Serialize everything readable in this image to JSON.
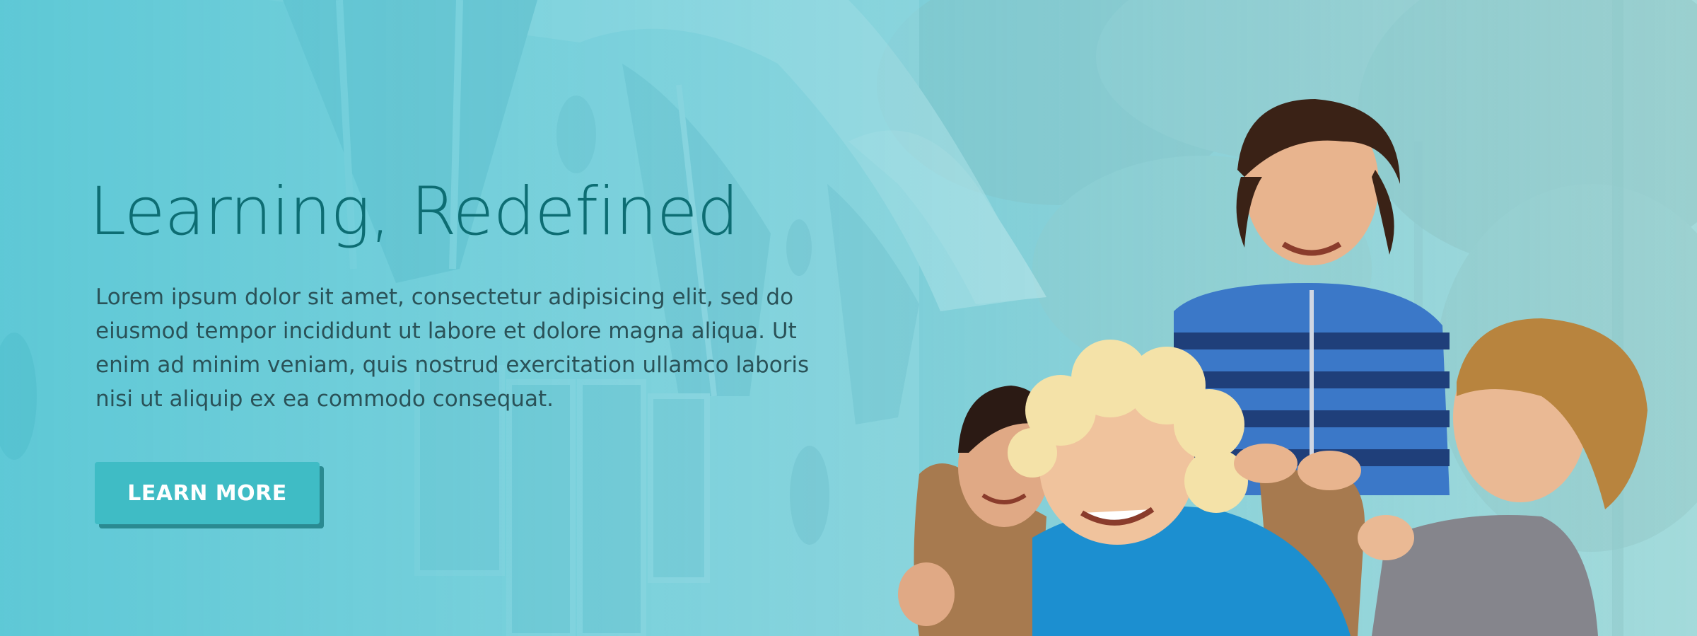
{
  "hero": {
    "headline": "Learning, Redefined",
    "body": "Lorem ipsum dolor sit amet, consectetur adipisicing elit, sed do eiusmod tempor incididunt ut labore et dolore magna aliqua. Ut enim ad minim veniam, quis nostrud exercitation ullamco laboris nisi ut aliquip ex ea commodo consequat.",
    "cta_label": "LEARN MORE"
  },
  "colors": {
    "overlay": "#5fcad8",
    "headline": "#0d6d73",
    "body_text": "#2a5258",
    "button": "#3fbcc5",
    "button_shadow": "#2a8a91",
    "button_text": "#ffffff"
  },
  "image": {
    "description_icon": "children-photo"
  }
}
